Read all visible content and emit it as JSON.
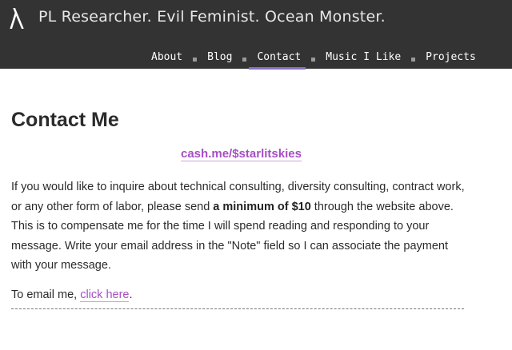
{
  "header": {
    "logo_icon": "lambda-icon",
    "site_title": "PL Researcher. Evil Feminist. Ocean Monster.",
    "nav": [
      {
        "label": "About",
        "active": false
      },
      {
        "label": "Blog",
        "active": false
      },
      {
        "label": "Contact",
        "active": true
      },
      {
        "label": "Music I Like",
        "active": false
      },
      {
        "label": "Projects",
        "active": false
      }
    ]
  },
  "main": {
    "title": "Contact Me",
    "cash_link": "cash.me/$starlitskies",
    "paragraph": {
      "before": "If you would like to inquire about technical consulting, diversity consulting, contract work, or any other form of labor, please send ",
      "bold": "a minimum of $10",
      "after": " through the website above. This is to compensate me for the time I will spend reading and responding to your message. Write your email address in the \"Note\" field so I can associate the payment with your message."
    },
    "email": {
      "prefix": "To email me, ",
      "link": "click here",
      "suffix": "."
    }
  },
  "colors": {
    "header_bg": "#333333",
    "link": "#a64ec4",
    "active_underline": "#8a6fc0"
  }
}
